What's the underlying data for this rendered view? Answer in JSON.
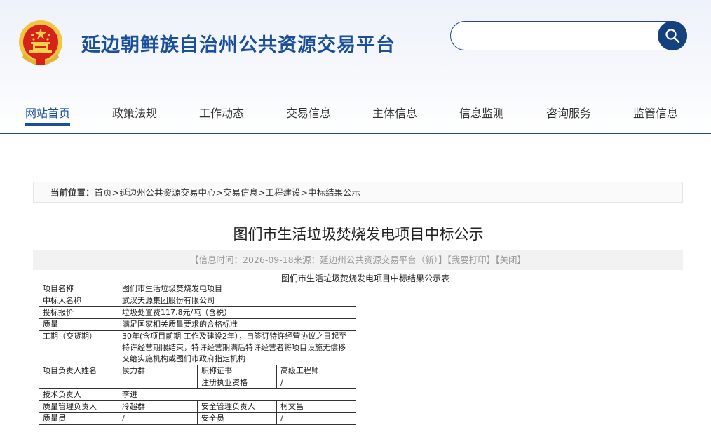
{
  "header": {
    "site_title": "延边朝鲜族自治州公共资源交易平台",
    "search_placeholder": "",
    "brand_color": "#1b4f9c",
    "emblem": "national-emblem"
  },
  "nav": {
    "items": [
      "网站首页",
      "政策法规",
      "工作动态",
      "交易信息",
      "主体信息",
      "信息监测",
      "咨询服务",
      "监管信息"
    ],
    "active_index": 0
  },
  "breadcrumb": {
    "label": "当前位置：",
    "items": [
      "首页",
      "延边州公共资源交易中心",
      "交易信息",
      "工程建设",
      "中标结果公示"
    ],
    "separator": ">"
  },
  "article": {
    "title": "图们市生活垃圾焚烧发电项目中标公示",
    "info_prefix": "【信息时间：",
    "info_time": "2026-09-18",
    "info_source_label": "来源：",
    "info_source": "延边州公共资源交易平台（新）",
    "info_suffix": "】",
    "print_label": "【我要打印】",
    "close_label": "【关闭】",
    "table_caption": "图们市生活垃圾焚烧发电项目中标结果公示表"
  },
  "table": {
    "project_name_label": "项目名称",
    "project_name": "图们市生活垃圾焚烧发电项目",
    "winner_label": "中标人名称",
    "winner": "武汉天源集团股份有限公司",
    "bid_label": "投标报价",
    "bid": "垃圾处置费117.8元/吨（含税）",
    "quality_label": "质量",
    "quality": "满足国家相关质量要求的合格标准",
    "period_label": "工期（交货期）",
    "period_lines": [
      "30年(含项目前期 工作及建设2年），自签订特许经营协议之日起至",
      "特许经营期限结束，特许经营期满后特许经营者将项目设施无偿移",
      "交给实施机构或图们市政府指定机构"
    ],
    "pm_label": "项目负责人姓名",
    "pm": "侯力群",
    "title_cert_label": "职称证书",
    "title_cert": "高级工程师",
    "reg_label": "注册执业资格",
    "reg": "/",
    "tech_label": "技术负责人",
    "tech": "李进",
    "qm_label": "质量管理负责人",
    "qm": "冷超群",
    "safety_mgr_label": "安全管理负责人",
    "safety_mgr": "柯文昌",
    "qc_label": "质量员",
    "qc": "/",
    "safety_label": "安全员",
    "safety": "/"
  }
}
